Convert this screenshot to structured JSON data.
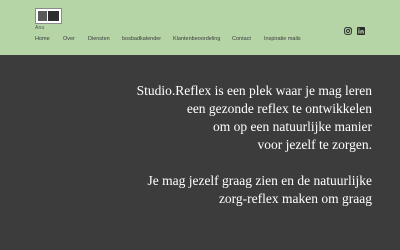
{
  "brand": {
    "logo_sub": "Anu"
  },
  "nav": {
    "items": [
      {
        "label": "Home"
      },
      {
        "label": "Over"
      },
      {
        "label": "Diensten"
      },
      {
        "label": "bosbadkalender"
      },
      {
        "label": "Klantenbeoordeling"
      },
      {
        "label": "Contact"
      },
      {
        "label": "Inspiratie mails"
      }
    ]
  },
  "social": [
    {
      "icon": "instagram-icon"
    },
    {
      "icon": "linkedin-icon"
    }
  ],
  "hero": {
    "lines": [
      "Studio.Reflex is een plek waar je mag leren",
      "een gezonde reflex te ontwikkelen",
      "om op een natuurlijke manier",
      "voor jezelf te zorgen.",
      "",
      "Je mag jezelf graag zien en de natuurlijke",
      "zorg-reflex maken om graag"
    ]
  },
  "colors": {
    "header_bg": "#b5d5a7",
    "page_bg": "#3c3c3c",
    "text": "#ffffff"
  }
}
